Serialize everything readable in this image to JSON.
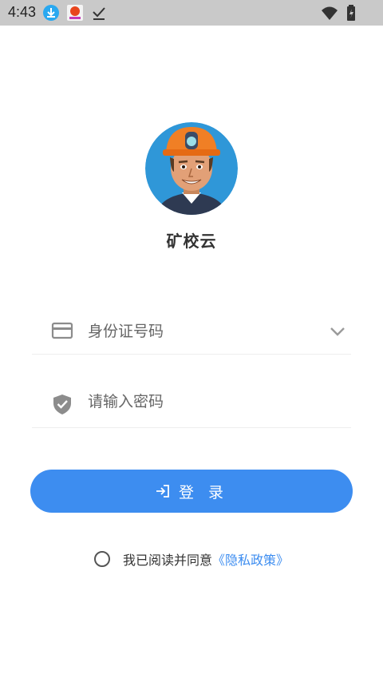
{
  "status_bar": {
    "time": "4:43",
    "icons": [
      "download-icon",
      "app-notification-icon",
      "check-icon",
      "wifi-icon",
      "battery-icon"
    ]
  },
  "app": {
    "name": "矿校云",
    "avatar": "miner-avatar"
  },
  "form": {
    "id_field": {
      "value": "身份证号码",
      "icon": "id-card-icon",
      "dropdown_icon": "chevron-down-icon"
    },
    "password_field": {
      "placeholder": "请输入密码",
      "icon": "shield-check-icon"
    }
  },
  "login_button": {
    "label": "登 录",
    "icon": "login-icon"
  },
  "agreement": {
    "text": "我已阅读并同意",
    "link": "《隐私政策》",
    "checked": false
  },
  "colors": {
    "accent": "#3d8df0",
    "status_bar": "#c9c9c9",
    "text": "#333333"
  }
}
